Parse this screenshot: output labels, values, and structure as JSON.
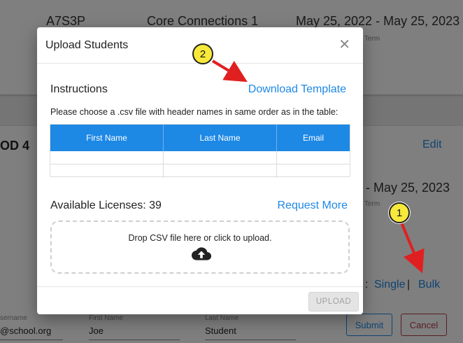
{
  "background": {
    "card1": {
      "code": "A7S3P",
      "class_name": "Core Connections 1",
      "dates": "May 25, 2022  -  May 25, 2023",
      "term_label": "Term"
    },
    "card2": {
      "period": "OD 4",
      "edit": "Edit",
      "dates": "-  May 25, 2023",
      "term_label": "Term",
      "add_prefix": ":",
      "single": "Single",
      "separator": "|",
      "bulk": "Bulk",
      "fields": [
        {
          "label": "sername",
          "value": "@school.org"
        },
        {
          "label": "First Name",
          "value": "Joe"
        },
        {
          "label": "Last Name",
          "value": "Student"
        }
      ],
      "submit": "Submit",
      "cancel": "Cancel"
    }
  },
  "modal": {
    "title": "Upload Students",
    "close_glyph": "✕",
    "instructions": "Instructions",
    "download_template": "Download Template",
    "hint": "Please choose a .csv file with header names in same order as in the table:",
    "table": {
      "columns": [
        "First Name",
        "Last Name",
        "Email"
      ],
      "empty_rows": 2
    },
    "licenses": "Available Licenses: 39",
    "request_more": "Request More",
    "dropzone_text": "Drop CSV file here or click to upload.",
    "upload_icon": "cloud-upload-icon",
    "upload_button": "UPLOAD"
  },
  "callouts": [
    {
      "number": "1"
    },
    {
      "number": "2"
    }
  ],
  "colors": {
    "accent": "#1e88e5",
    "cancel": "#b03a4a",
    "callout_fill": "#f7e93a",
    "arrow": "#e02020"
  }
}
